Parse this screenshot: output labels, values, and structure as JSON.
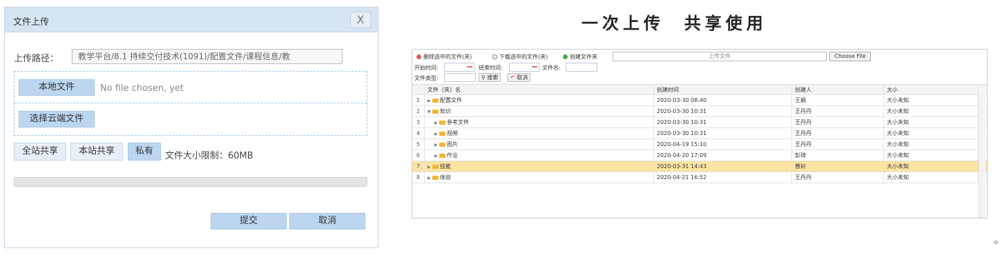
{
  "dialog": {
    "title": "文件上传",
    "close_label": "X",
    "path_label": "上传路径：",
    "path_value": "教学平台/8.1 持续交付技术(1091)/配置文件/课程信息/教",
    "local_file_button": "本地文件",
    "no_file_text": "No file chosen, yet",
    "cloud_file_button": "选择云端文件",
    "share_all_button": "全站共享",
    "share_site_button": "本站共享",
    "private_button": "私有",
    "size_limit": "文件大小限制：60MB",
    "progress": 0,
    "submit_button": "提交",
    "cancel_button": "取消"
  },
  "slogan": "一次上传  共享使用",
  "panel": {
    "toolbar": {
      "delete_label": "删除选中的文件(夹)",
      "download_label": "下载选中的文件(夹)",
      "create_folder_label": "创建文件夹",
      "upload_placeholder": "上传文件",
      "choose_file_label": "Choose File"
    },
    "filters": {
      "start_time_label": "开始时间:",
      "end_time_label": "结束时间:",
      "file_name_label": "文件名:",
      "file_type_label": "文件类型:",
      "search_button": "搜索",
      "cancel_button": "取消"
    },
    "columns": [
      "文件（夹）名",
      "创建时间",
      "创建人",
      "大小"
    ],
    "rows": [
      {
        "no": "1",
        "name": "配置文件",
        "date": "2020-03-30 08:40",
        "user": "王娟",
        "size": "大小未知",
        "indent": 0,
        "expanded": false,
        "selected": false
      },
      {
        "no": "2",
        "name": "知识",
        "date": "2020-03-30 10:31",
        "user": "王丹丹",
        "size": "大小未知",
        "indent": 0,
        "expanded": true,
        "selected": false
      },
      {
        "no": "3",
        "name": "参考文件",
        "date": "2020-03-30 10:31",
        "user": "王丹丹",
        "size": "大小未知",
        "indent": 1,
        "expanded": false,
        "selected": false
      },
      {
        "no": "4",
        "name": "视频",
        "date": "2020-03-30 10:31",
        "user": "王丹丹",
        "size": "大小未知",
        "indent": 1,
        "expanded": false,
        "selected": false
      },
      {
        "no": "5",
        "name": "图片",
        "date": "2020-04-19 15:10",
        "user": "王丹丹",
        "size": "大小未知",
        "indent": 1,
        "expanded": false,
        "selected": false
      },
      {
        "no": "6",
        "name": "作业",
        "date": "2020-04-20 17:09",
        "user": "彭琦",
        "size": "大小未知",
        "indent": 1,
        "expanded": false,
        "selected": false
      },
      {
        "no": "7",
        "name": "技能",
        "date": "2020-03-31 14:43",
        "user": "曾好",
        "size": "大小未知",
        "indent": 0,
        "expanded": false,
        "selected": true
      },
      {
        "no": "8",
        "name": "体验",
        "date": "2020-04-21 16:52",
        "user": "王丹丹",
        "size": "大小未知",
        "indent": 0,
        "expanded": false,
        "selected": false
      }
    ]
  },
  "colors": {
    "accent": "#bcd6f0",
    "header": "#d7e4f2",
    "selected_row": "#fbe3a3",
    "folder": "#f2b636",
    "delete_icon": "#e05a4f",
    "download_icon": "#7a7a7a",
    "create_icon": "#3fae49"
  },
  "corner_glyph": "⟡"
}
